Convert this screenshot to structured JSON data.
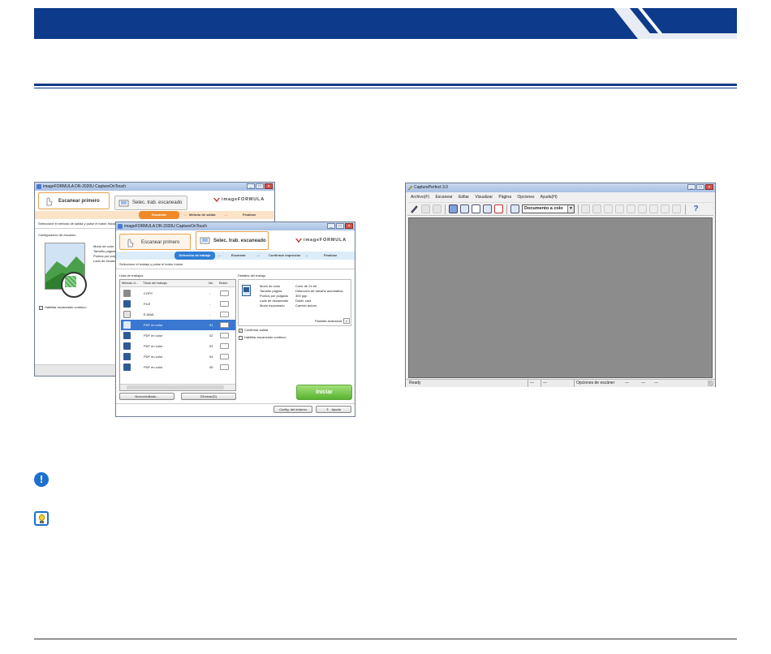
{
  "cot_back": {
    "title": "imageFORMULA DR-2020U CaptureOnTouch",
    "tab_scan_first": "Escanear primero",
    "tab_select_job": "Selec. trab. escaneado",
    "logo": "imageFORMULA",
    "steps": [
      "Escanear",
      "Método de salida",
      "Finalizar"
    ],
    "instruction": "Seleccione el método de salida y pulse el botón Iniciar",
    "settings_label": "Configuración de escaneo",
    "settings_lines": [
      "Modo de color",
      "Tamaño página",
      "Puntos por pulgada",
      "Lado de escaneado"
    ],
    "checkbox_label": "Habilitar escaneado continuo"
  },
  "cot_front": {
    "title": "imageFORMULA DR-2020U CaptureOnTouch",
    "tab_scan_first": "Escanear primero",
    "tab_select_job": "Selec. trab. escaneado",
    "logo": "imageFORMULA",
    "steps": [
      "Selección de trabajo",
      "Escanear",
      "Confirmar impresión",
      "Finalizar"
    ],
    "instruction": "Seleccione el trabajo y pulse el botón Iniciar",
    "job_list": {
      "title": "Lista de trabajos",
      "headers": [
        "Método d...",
        "Título del trabajo",
        "No.",
        "Botón"
      ],
      "rows": [
        {
          "label": "COPY",
          "num": "-"
        },
        {
          "label": "FILE",
          "num": "-"
        },
        {
          "label": "E-MAIL",
          "num": "-"
        },
        {
          "label": "PDF en color",
          "num": "01"
        },
        {
          "label": "PDF en color",
          "num": "02"
        },
        {
          "label": "PDF en color",
          "num": "03"
        },
        {
          "label": "PDF en color",
          "num": "04"
        },
        {
          "label": "PDF en color",
          "num": "05"
        }
      ],
      "selected_index": 3
    },
    "details": {
      "title": "Detalles del trabajo",
      "rows": [
        {
          "k": "Modo de color",
          "v": "Color de 24 bit"
        },
        {
          "k": "Tamaño página",
          "v": "Detección de tamaño automática"
        },
        {
          "k": "Puntos por pulgada",
          "v": "300 ppp"
        },
        {
          "k": "Lado de escaneado",
          "v": "Doble cara"
        },
        {
          "k": "Modo escaneado",
          "v": "Cambio autom."
        }
      ],
      "advanced": "Pantalla avanzada"
    },
    "check_confirm": "Confirmar salida",
    "check_continuous": "Habilitar escaneado continuo",
    "btn_new": "Nuevo/editado...",
    "btn_delete": "Eliminar(D)",
    "btn_start": "Iniciar",
    "btn_env": "Config. del entorno",
    "btn_help_icon": "?",
    "btn_help": "Ayuda"
  },
  "capture_perfect": {
    "title": "CapturePerfect 3.0",
    "menu": [
      "Archivo(F)",
      "Escanear",
      "Editar",
      "Visualizar",
      "Página",
      "Opciones",
      "Ayuda(H)"
    ],
    "preset": "Documento a colo",
    "status_ready": "Ready",
    "status_cells": [
      "---",
      "---",
      "Opciones de escáner",
      "---",
      "---",
      "---"
    ]
  },
  "notes": {
    "warn_glyph": "!"
  }
}
